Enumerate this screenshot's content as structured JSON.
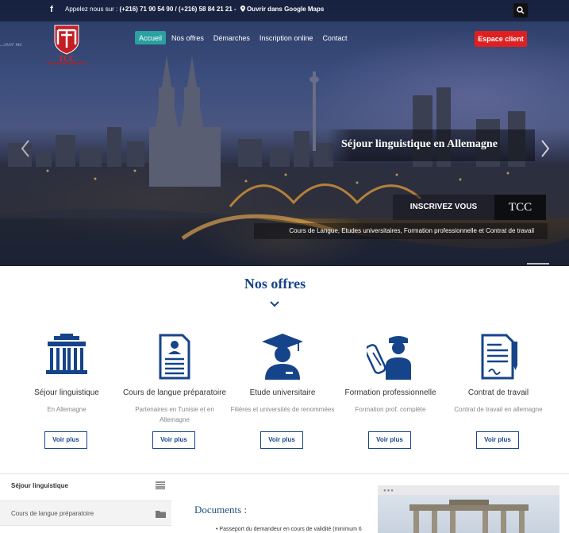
{
  "topbar": {
    "contact_prefix": "Appelez nous sur :",
    "phones": "(+216) 71 90 54 90 / (+216) 58 84 21 21 -",
    "maps_link": "Ouvrir dans Google Maps",
    "icons": [
      "facebook-icon",
      "map-pin-icon",
      "search-icon"
    ]
  },
  "logo": {
    "text": "TCC",
    "tagline": "...over me"
  },
  "nav": {
    "items": [
      {
        "label": "Accueil",
        "active": true
      },
      {
        "label": "Nos offres",
        "active": false
      },
      {
        "label": "Démarches",
        "active": false
      },
      {
        "label": "Inscription online",
        "active": false
      },
      {
        "label": "Contact",
        "active": false
      }
    ],
    "espace_client": "Espace client"
  },
  "hero": {
    "slide_title": "Séjour linguistique en Allemagne",
    "cta": "INSCRIVEZ VOUS",
    "brand": "TCC",
    "subtitle": "Cours de Langue, Etudes universitaires, Formation professionnelle et Contrat de travail"
  },
  "offres": {
    "title": "Nos offres",
    "items": [
      {
        "title": "Séjour linguistique",
        "desc": "En Allemagne",
        "button": "Voir plus",
        "icon": "brandenburg-gate-icon"
      },
      {
        "title": "Cours de langue préparatoire",
        "desc": "Partenaires en Tunisie et en Allemagne",
        "button": "Voir plus",
        "icon": "document-icon"
      },
      {
        "title": "Etude universitaire",
        "desc": "Filières et universités de renommées",
        "button": "Voir plus",
        "icon": "graduate-icon"
      },
      {
        "title": "Formation professionnelle",
        "desc": "Formation prof. complète",
        "button": "Voir plus",
        "icon": "engineer-icon"
      },
      {
        "title": "Contrat de travail",
        "desc": "Contrat de travail en allemagne",
        "button": "Voir plus",
        "icon": "contract-icon"
      }
    ]
  },
  "sidebar": {
    "heading": "Séjour linguistique",
    "items": [
      {
        "label": "Cours de langue préparatoire"
      }
    ]
  },
  "documents": {
    "title": "Documents :",
    "first_item": "• Passeport du demandeur en cours de validité (minimum 6"
  },
  "colors": {
    "brand_blue": "#16448a",
    "accent_red": "#e02020",
    "nav_active": "#2aa0a0"
  }
}
